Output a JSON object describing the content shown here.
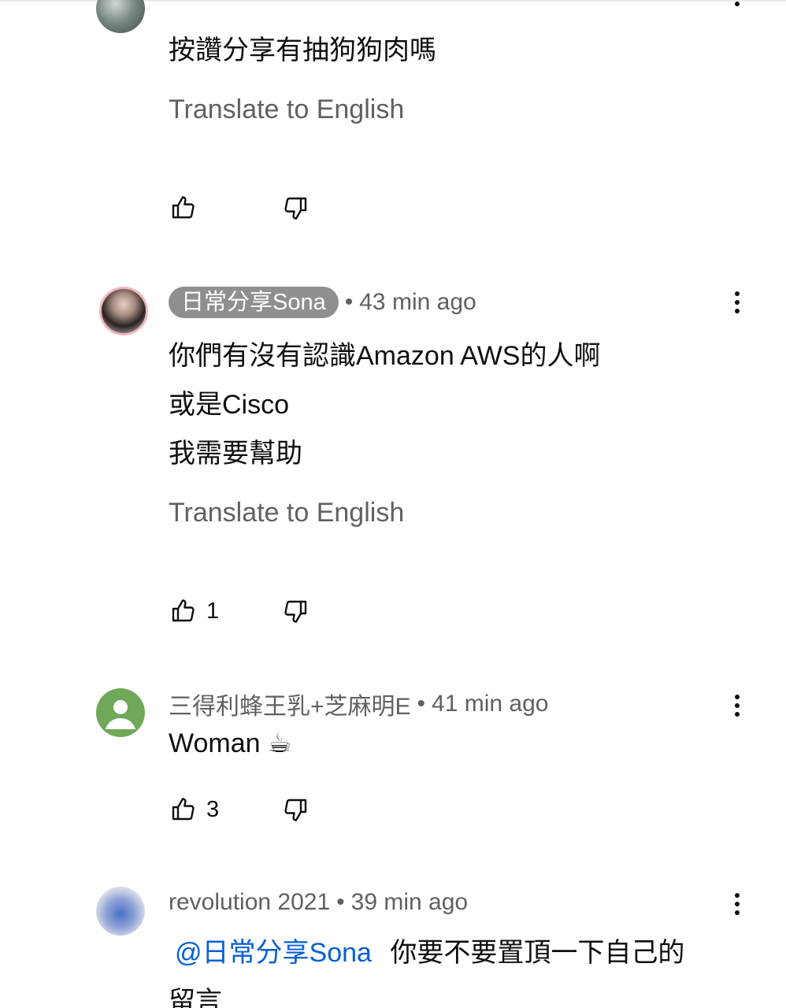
{
  "comments": [
    {
      "author": "",
      "time": "",
      "lines": [
        "按讚分享有抽狗狗肉嗎"
      ],
      "translate_label": "Translate to English",
      "likes": "",
      "avatar": "photo-avatar"
    },
    {
      "author": "日常分享Sona",
      "separator": "•",
      "time": "43 min ago",
      "lines": [
        "你們有沒有認識Amazon AWS的人啊",
        "或是Cisco",
        "我需要幫助"
      ],
      "translate_label": "Translate to English",
      "likes": "1",
      "avatar": "photo-avatar"
    },
    {
      "author": "三得利蜂王乳+芝麻明E",
      "separator": "•",
      "time": "41 min ago",
      "lines": [
        "Woman ☕"
      ],
      "likes": "3",
      "avatar": "default-avatar",
      "avatar_color": "#6fa858"
    },
    {
      "author": "revolution 2021",
      "separator": "•",
      "time": "39 min ago",
      "mention": "@日常分享Sona",
      "lines": [
        "你要不要置頂一下自己的",
        "留言"
      ],
      "avatar": "photo-avatar"
    }
  ],
  "icons": {
    "like": "thumbs-up-icon",
    "dislike": "thumbs-down-icon",
    "menu": "more-vert-icon"
  },
  "colors": {
    "mention": "#065fd4",
    "chip": "#8f8f8f",
    "secondary_text": "#606060"
  }
}
